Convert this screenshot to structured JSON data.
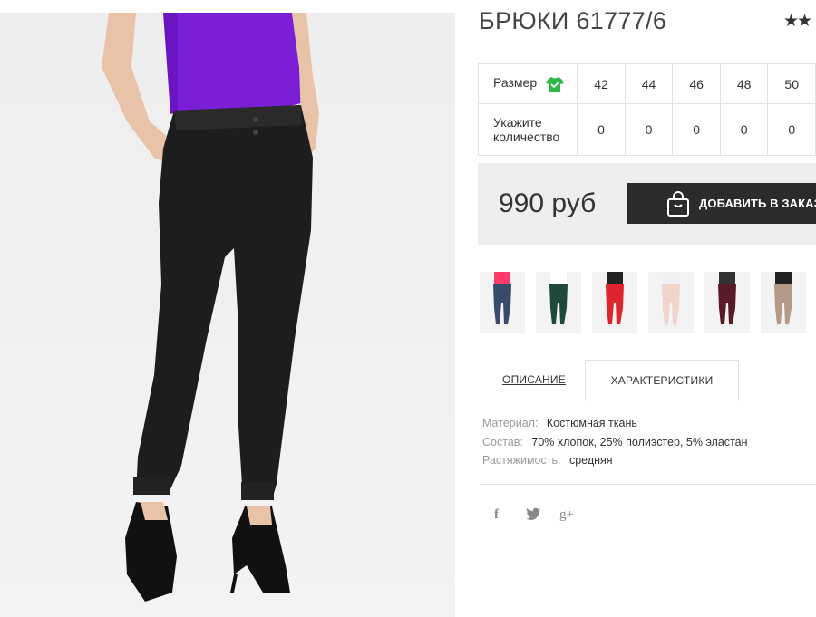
{
  "product": {
    "title": "БРЮКИ 61777/6",
    "rating_text": "★★"
  },
  "sizes": {
    "header_label": "Размер",
    "qty_label": "Укажите количество",
    "columns": [
      "42",
      "44",
      "46",
      "48",
      "50"
    ],
    "quantities": [
      "0",
      "0",
      "0",
      "0",
      "0"
    ]
  },
  "buy": {
    "price": "990 руб",
    "add_label": "ДОБАВИТЬ В ЗАКАЗ"
  },
  "thumbnails": [
    {
      "top": "#ff3b6b",
      "pants": "#3a4a6b"
    },
    {
      "top": "#ffffff",
      "pants": "#1f4a3a"
    },
    {
      "top": "#222222",
      "pants": "#e0242e"
    },
    {
      "top": "#f0f0f0",
      "pants": "#f1d4cc"
    },
    {
      "top": "#333333",
      "pants": "#5a1a26"
    },
    {
      "top": "#222222",
      "pants": "#b49a88"
    }
  ],
  "tabs": {
    "description": "ОПИСАНИЕ",
    "characteristics": "ХАРАКТЕРИСТИКИ"
  },
  "specs": [
    {
      "key": "Материал:",
      "value": "Костюмная ткань"
    },
    {
      "key": "Состав:",
      "value": "70% хлопок, 25% полиэстер, 5% эластан"
    },
    {
      "key": "Растяжимость:",
      "value": "средняя"
    }
  ],
  "social": {
    "facebook": "f",
    "twitter": "🐦",
    "googleplus": "g+"
  },
  "icons": {
    "size_guide": "tshirt-icon",
    "cart": "shopping-bag-icon"
  },
  "colors": {
    "accent_green": "#2fb84a",
    "button_dark": "#2b2b2b",
    "box_gray": "#eeeeee",
    "top_purple": "#7a1fd6"
  }
}
